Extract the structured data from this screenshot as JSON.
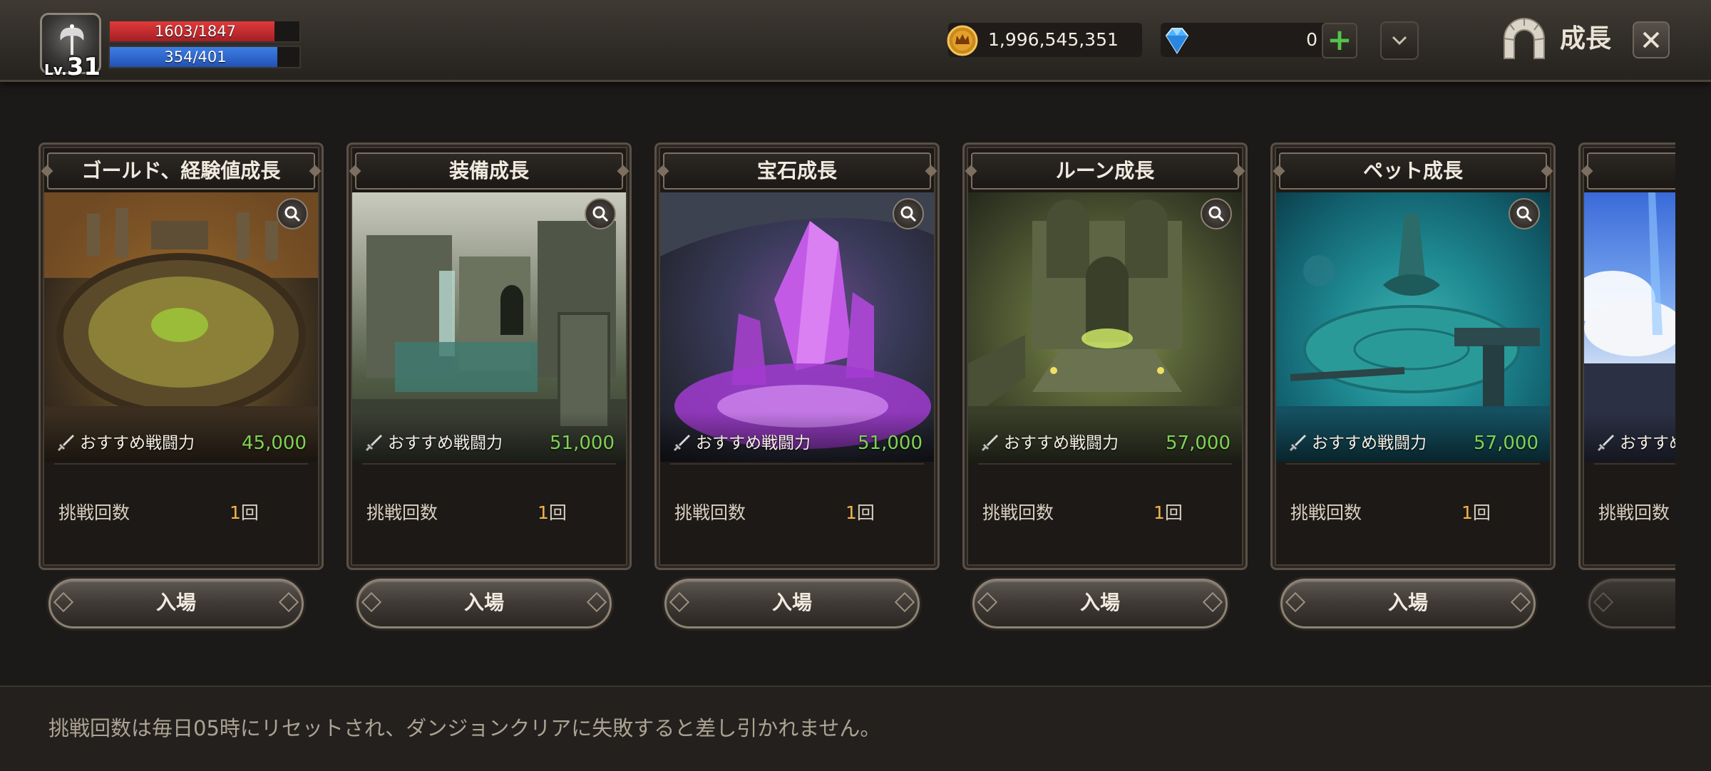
{
  "player": {
    "level_prefix": "Lv.",
    "level": "31",
    "hp_text": "1603/1847",
    "hp_fraction": 0.868,
    "mp_text": "354/401",
    "mp_fraction": 0.883
  },
  "currency": {
    "gold": "1,996,545,351",
    "gems": "0",
    "gold_icon": "crown-coin-icon",
    "gem_icon": "diamond-icon",
    "add_label": "+"
  },
  "header": {
    "title": "成長",
    "title_icon": "stone-gate-icon"
  },
  "dungeons": [
    {
      "title": "ゴールド、経験値成長",
      "power_label": "おすすめ戦闘力",
      "power": "45,000",
      "tries_label": "挑戦回数",
      "tries_count": "1",
      "tries_unit": "回",
      "enter_label": "入場",
      "theme": "arena"
    },
    {
      "title": "装備成長",
      "power_label": "おすすめ戦闘力",
      "power": "51,000",
      "tries_label": "挑戦回数",
      "tries_count": "1",
      "tries_unit": "回",
      "enter_label": "入場",
      "theme": "ruins"
    },
    {
      "title": "宝石成長",
      "power_label": "おすすめ戦闘力",
      "power": "51,000",
      "tries_label": "挑戦回数",
      "tries_count": "1",
      "tries_unit": "回",
      "enter_label": "入場",
      "theme": "crystal"
    },
    {
      "title": "ルーン成長",
      "power_label": "おすすめ戦闘力",
      "power": "57,000",
      "tries_label": "挑戦回数",
      "tries_count": "1",
      "tries_unit": "回",
      "enter_label": "入場",
      "theme": "temple"
    },
    {
      "title": "ペット成長",
      "power_label": "おすすめ戦闘力",
      "power": "57,000",
      "tries_label": "挑戦回数",
      "tries_count": "1",
      "tries_unit": "回",
      "enter_label": "入場",
      "theme": "underwater"
    },
    {
      "title": "",
      "power_label": "おすすめ",
      "power": "",
      "tries_label": "挑戦回数",
      "tries_count": "",
      "tries_unit": "",
      "enter_label": "",
      "theme": "sky"
    }
  ],
  "footer": {
    "note": "挑戦回数は毎日05時にリセットされ、ダンジョンクリアに失敗すると差し引かれません。"
  },
  "colors": {
    "hp": "#d6323a",
    "mp": "#2f6ed4",
    "power_value": "#7fd354",
    "tries_count": "#f0b64a",
    "gem_plus": "#54c44a"
  }
}
